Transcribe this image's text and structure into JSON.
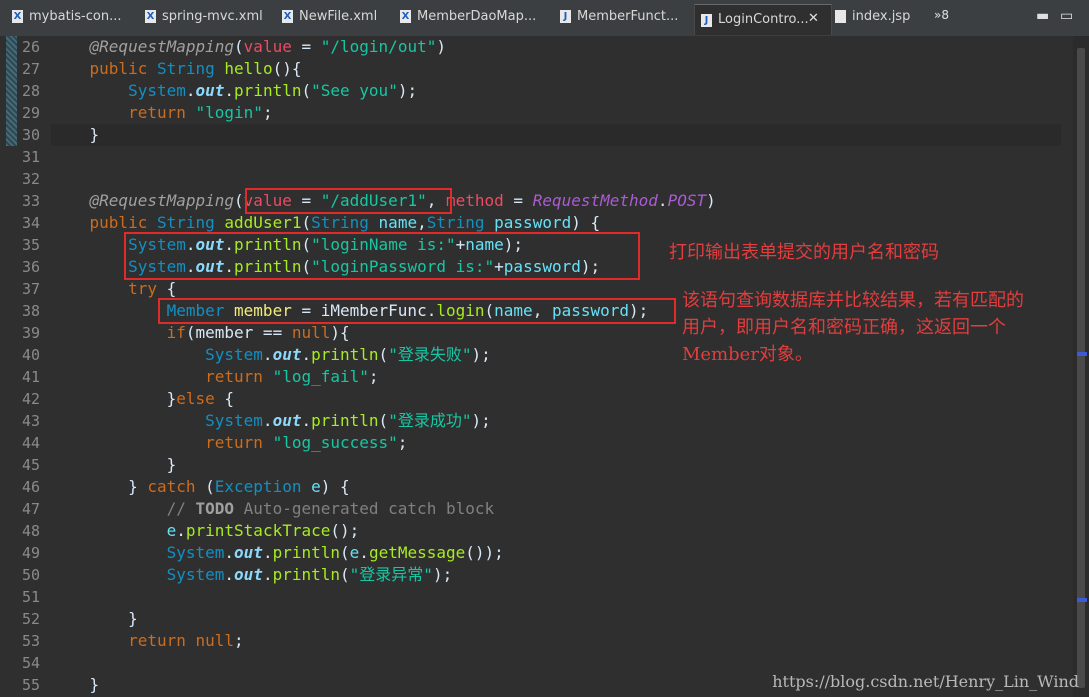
{
  "tabs": [
    {
      "label": "mybatis-con...",
      "icon": "xml-file-icon",
      "glyph": "X",
      "active": false
    },
    {
      "label": "spring-mvc.xml",
      "icon": "xml-file-icon",
      "glyph": "X",
      "active": false
    },
    {
      "label": "NewFile.xml",
      "icon": "xml-file-icon",
      "glyph": "X",
      "active": false
    },
    {
      "label": "MemberDaoMap...",
      "icon": "xml-file-icon",
      "glyph": "X",
      "active": false
    },
    {
      "label": "MemberFunct...",
      "icon": "java-file-icon",
      "glyph": "J",
      "active": false
    },
    {
      "label": "LoginContro...",
      "icon": "java-file-icon",
      "glyph": "J",
      "active": true
    },
    {
      "label": "index.jsp",
      "icon": "jsp-file-icon",
      "glyph": "",
      "active": false
    }
  ],
  "tab_close": "✕",
  "overflow": "»8",
  "window_buttons": {
    "minimize": "▬",
    "maximize": "▭"
  },
  "line_numbers": [
    "26",
    "27",
    "28",
    "29",
    "30",
    "31",
    "32",
    "33",
    "34",
    "35",
    "36",
    "37",
    "38",
    "39",
    "40",
    "41",
    "42",
    "43",
    "44",
    "45",
    "46",
    "47",
    "48",
    "49",
    "50",
    "51",
    "52",
    "53",
    "54",
    "55"
  ],
  "notes": {
    "note1": "打印输出表单提交的用户名和密码",
    "note2_l1": "该语句查询数据库并比较结果，若有匹配的",
    "note2_l2": "用户，即用户名和密码正确，这返回一个",
    "note2_l3": "Member对象。"
  },
  "watermark": "https://blog.csdn.net/Henry_Lin_Wind",
  "colors": {
    "note_red": "#e33d3d",
    "box_red": "#e12a2a",
    "editor_bg": "#2f2f2f"
  }
}
